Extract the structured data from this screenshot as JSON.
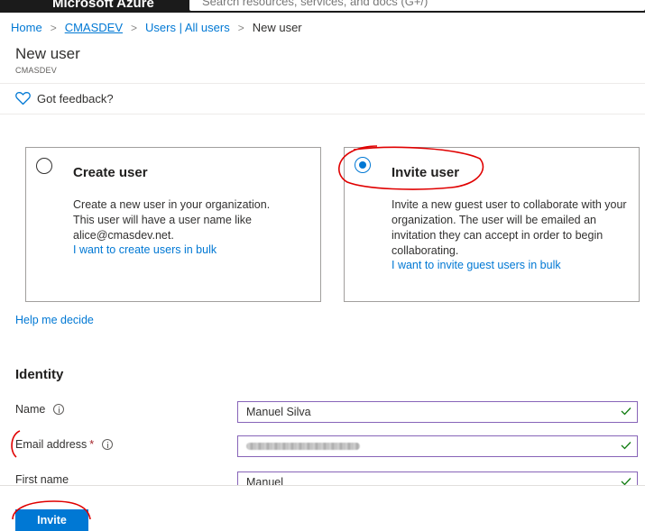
{
  "topbar": {
    "brand": "Microsoft Azure",
    "search_placeholder": "Search resources, services, and docs (G+/)"
  },
  "breadcrumb": {
    "items": [
      "Home",
      "CMASDEV",
      "Users | All users",
      "New user"
    ]
  },
  "page": {
    "title": "New user",
    "subtitle": "CMASDEV"
  },
  "feedback": {
    "label": "Got feedback?"
  },
  "options": {
    "create": {
      "title": "Create user",
      "description": "Create a new user in your organization. This user will have a user name like alice@cmasdev.net.",
      "link": "I want to create users in bulk",
      "selected": false
    },
    "invite": {
      "title": "Invite user",
      "description": "Invite a new guest user to collaborate with your organization. The user will be emailed an invitation they can accept in order to begin collaborating.",
      "link": "I want to invite guest users in bulk",
      "selected": true
    }
  },
  "help_link": "Help me decide",
  "identity": {
    "section_title": "Identity",
    "fields": {
      "name": {
        "label": "Name",
        "value": "Manuel Silva"
      },
      "email": {
        "label": "Email address",
        "required_mark": "*"
      },
      "first_name": {
        "label": "First name",
        "value": "Manuel"
      }
    }
  },
  "footer": {
    "invite_label": "Invite"
  },
  "colors": {
    "accent": "#0078d4",
    "focus_border": "#8764b8",
    "valid_check": "#107c10",
    "annotation": "#e00000"
  }
}
